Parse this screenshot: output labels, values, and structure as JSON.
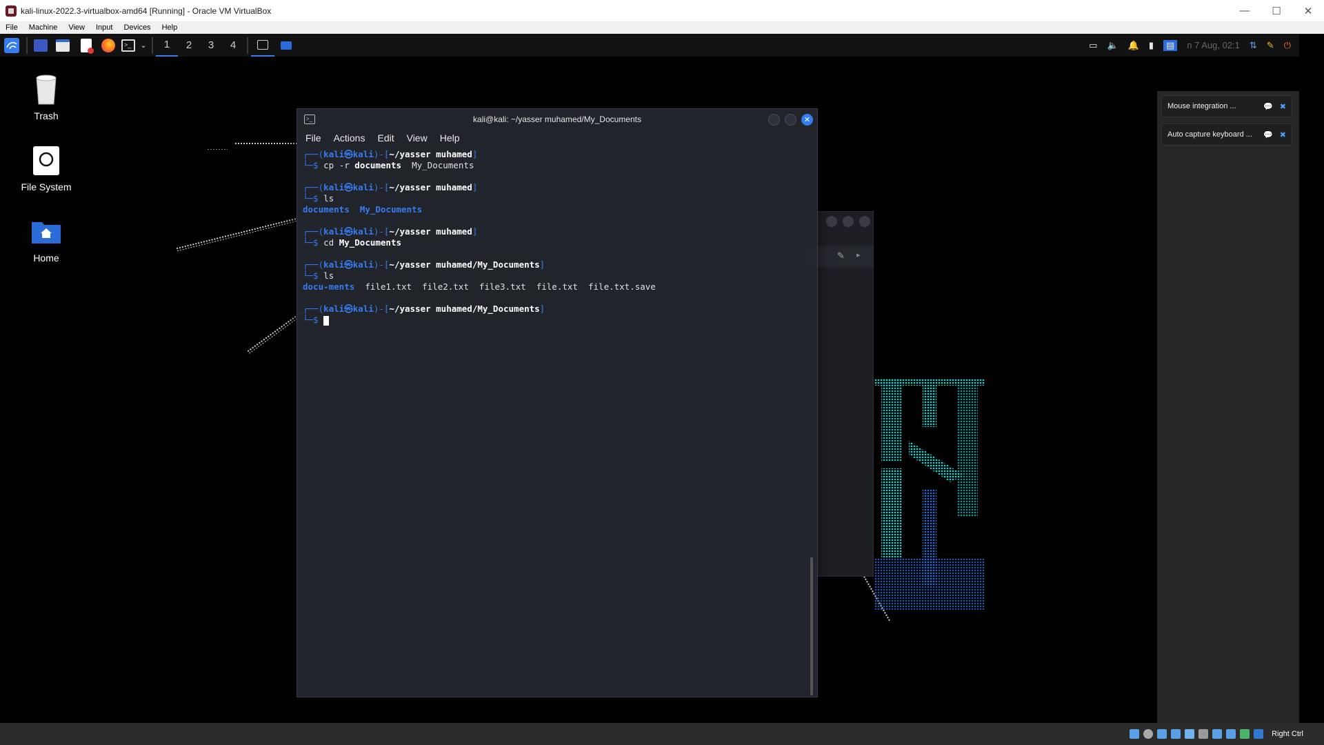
{
  "host": {
    "title": "kali-linux-2022.3-virtualbox-amd64 [Running] - Oracle VM VirtualBox",
    "menu": [
      "File",
      "Machine",
      "View",
      "Input",
      "Devices",
      "Help"
    ],
    "status_right": "Right Ctrl"
  },
  "panel": {
    "workspaces": [
      "1",
      "2",
      "3",
      "4"
    ],
    "clock": "n 7 Aug, 02:1"
  },
  "desktop": {
    "icons": [
      {
        "label": "Trash"
      },
      {
        "label": "File System"
      },
      {
        "label": "Home"
      }
    ]
  },
  "terminal": {
    "title": "kali@kali: ~/yasser muhamed/My_Documents",
    "menu": [
      "File",
      "Actions",
      "Edit",
      "View",
      "Help"
    ],
    "prompts": [
      {
        "user": "kali",
        "host": "kali",
        "path": "~/yasser muhamed",
        "cmd": "cp",
        "args": "-r",
        "target": "documents",
        "rest": "My_Documents"
      },
      {
        "user": "kali",
        "host": "kali",
        "path": "~/yasser muhamed",
        "cmd": "ls"
      },
      {
        "user": "kali",
        "host": "kali",
        "path": "~/yasser muhamed",
        "cmd": "cd",
        "target": "My_Documents"
      },
      {
        "user": "kali",
        "host": "kali",
        "path": "~/yasser muhamed/My_Documents",
        "cmd": "ls"
      },
      {
        "user": "kali",
        "host": "kali",
        "path": "~/yasser muhamed/My_Documents"
      }
    ],
    "ls1": {
      "dirs": [
        "documents",
        "My_Documents"
      ]
    },
    "ls2": {
      "dirs": [
        "docu-ments"
      ],
      "files": [
        "file1.txt",
        "file2.txt",
        "file3.txt",
        "file.txt",
        "file.txt.save"
      ]
    }
  },
  "notifications": [
    {
      "text": "Mouse integration ..."
    },
    {
      "text": "Auto capture keyboard ..."
    }
  ]
}
